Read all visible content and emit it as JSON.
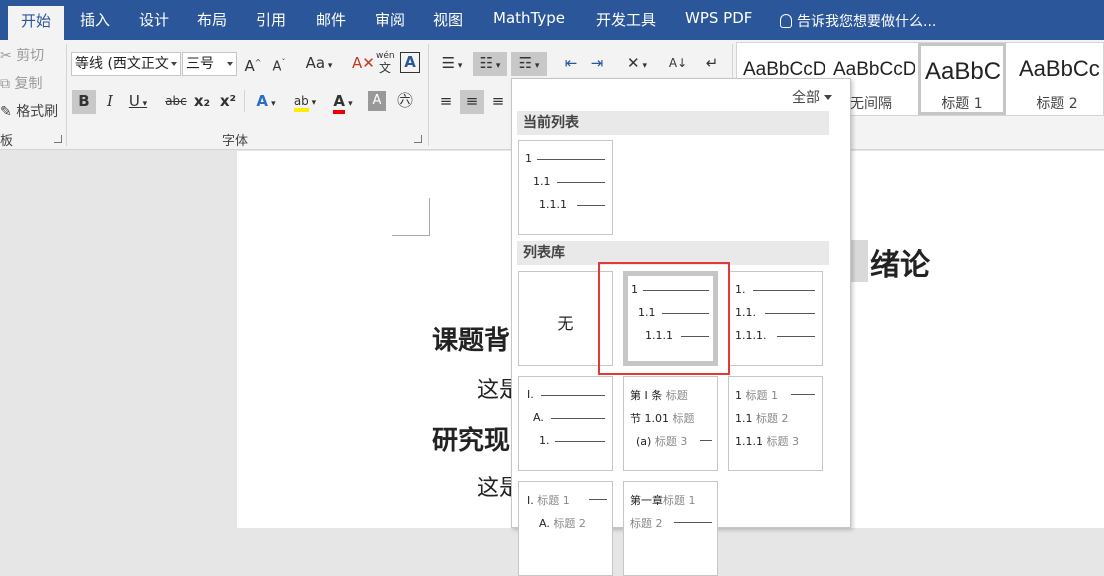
{
  "tabs": [
    "开始",
    "插入",
    "设计",
    "布局",
    "引用",
    "邮件",
    "审阅",
    "视图",
    "MathType",
    "开发工具",
    "WPS PDF"
  ],
  "tell_me": "告诉我您想要做什么...",
  "clipboard": {
    "cut": "剪切",
    "copy": "复制",
    "format_painter": "格式刷",
    "group_label": "板"
  },
  "font": {
    "name": "等线 (西文正文",
    "size": "三号",
    "case": "Aa",
    "group_label": "字体",
    "bold": "B",
    "italic": "I",
    "underline": "U",
    "strike": "abc",
    "sub": "x₂",
    "sup": "x²",
    "phonetic_top": "wén",
    "phonetic_bottom": "文",
    "boxed": "A"
  },
  "styles": {
    "items": [
      {
        "preview": "AaBbCcDc",
        "name": ""
      },
      {
        "preview": "AaBbCcDc",
        "name": "无间隔"
      },
      {
        "preview": "AaBbC",
        "name": "标题 1"
      },
      {
        "preview": "AaBbCc",
        "name": "标题 2"
      }
    ]
  },
  "dropdown": {
    "filter": "全部",
    "current_section": "当前列表",
    "library_section": "列表库",
    "none_label": "无",
    "current": [
      {
        "n": "1"
      },
      {
        "n": "1.1"
      },
      {
        "n": "1.1.1"
      }
    ],
    "lib1": [
      {
        "n": "1"
      },
      {
        "n": "1.1"
      },
      {
        "n": "1.1.1"
      }
    ],
    "lib2": [
      {
        "n": "1."
      },
      {
        "n": "1.1."
      },
      {
        "n": "1.1.1."
      }
    ],
    "lib3": [
      {
        "n": "I."
      },
      {
        "n": "A."
      },
      {
        "n": "1."
      }
    ],
    "lib4": [
      {
        "n": "第 I 条",
        "h": "标题"
      },
      {
        "n": "节 1.01",
        "h": "标题"
      },
      {
        "n": "(a)",
        "h": "标题 3"
      }
    ],
    "lib5": [
      {
        "n": "1",
        "h": "标题 1"
      },
      {
        "n": "1.1",
        "h": "标题 2"
      },
      {
        "n": "1.1.1",
        "h": "标题 3"
      }
    ],
    "lib6": [
      {
        "n": "I.",
        "h": "标题 1"
      },
      {
        "n": "A.",
        "h": "标题 2"
      }
    ],
    "lib7": [
      {
        "n": "第一章",
        "h": "标题 1"
      },
      {
        "n": "",
        "h": "标题 2"
      }
    ]
  },
  "document": {
    "heading1": "绪论",
    "heading2a": "课题背",
    "heading2b": "研究现",
    "para": "这是"
  }
}
